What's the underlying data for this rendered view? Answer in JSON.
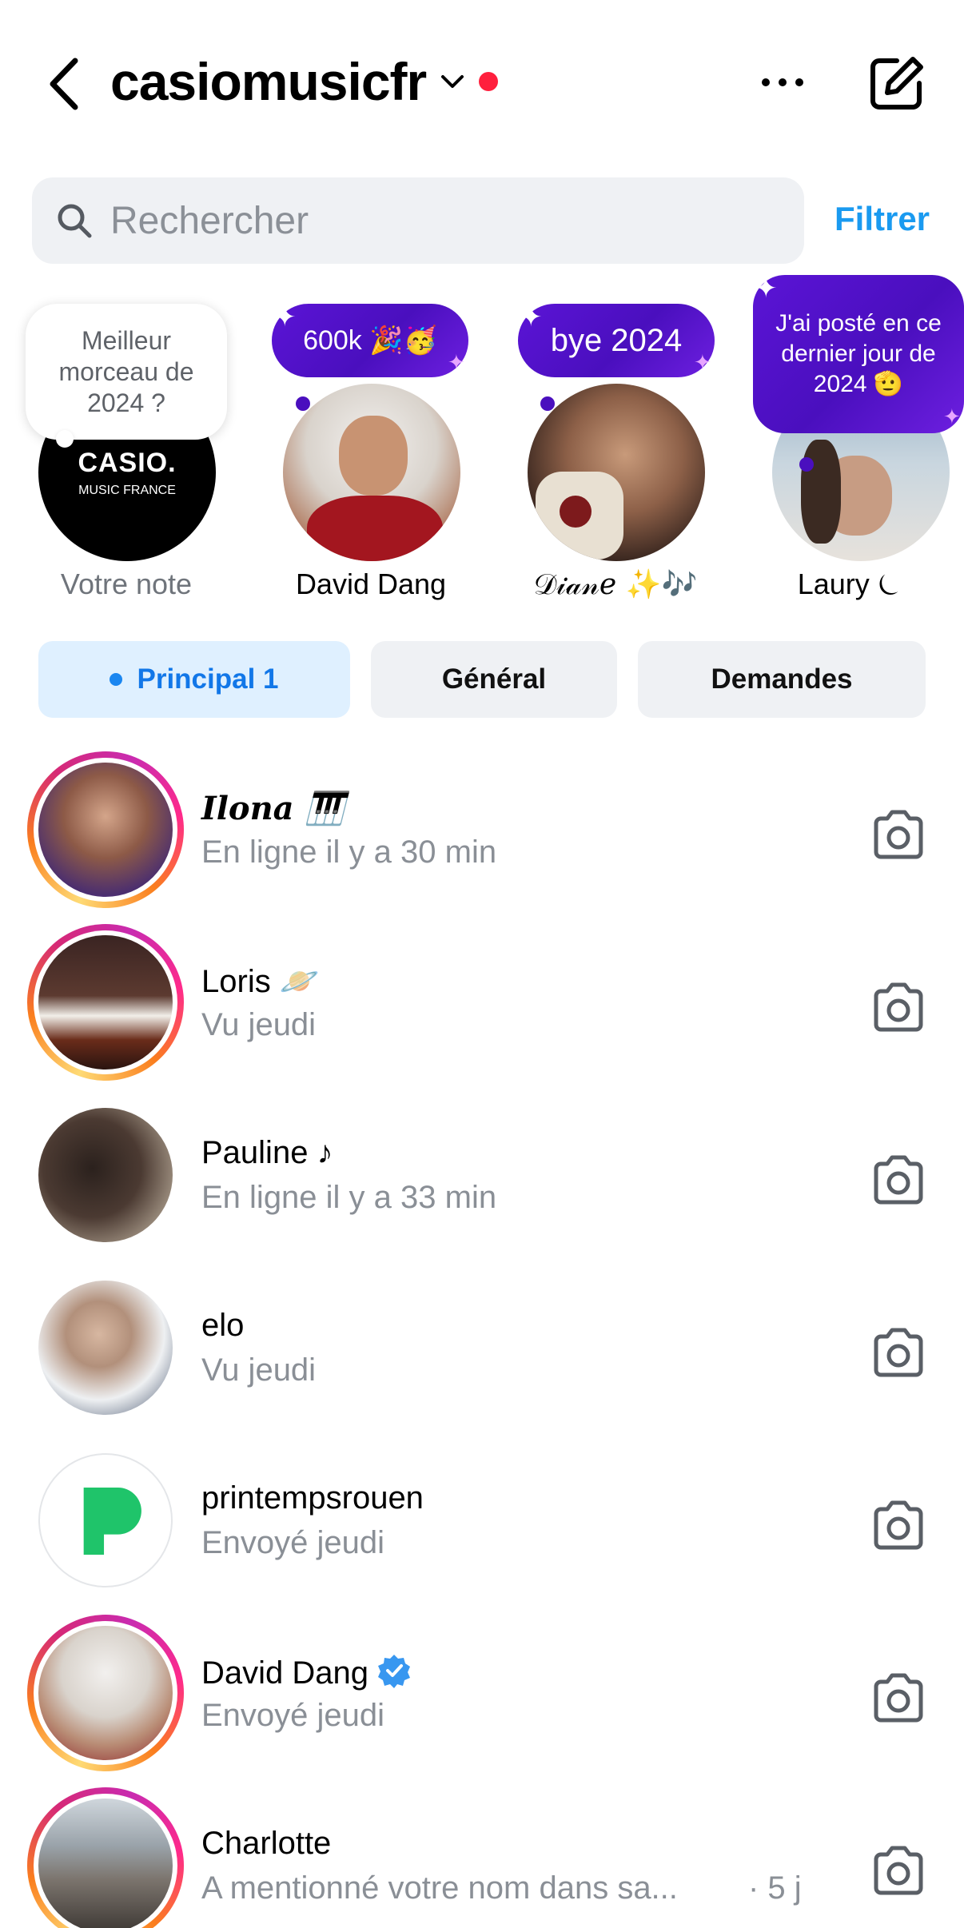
{
  "header": {
    "account_name": "casiomusicfr"
  },
  "search": {
    "placeholder": "Rechercher",
    "filter_label": "Filtrer"
  },
  "notes": [
    {
      "label": "Votre note",
      "note_text": "Meilleur morceau de 2024 ?",
      "avatar_text_1": "CASIO.",
      "avatar_text_2": "MUSIC FRANCE"
    },
    {
      "label": "David Dang",
      "note_text": "600k 🎉🥳"
    },
    {
      "label": "𝒟𝒾𝒶𝓃𝑒 ✨🎶",
      "note_text": "bye 2024"
    },
    {
      "label": "Laury ⏾",
      "note_text": "J'ai posté en ce dernier jour de 2024 🫡"
    }
  ],
  "tabs": [
    {
      "label": "Principal 1"
    },
    {
      "label": "Général"
    },
    {
      "label": "Demandes"
    }
  ],
  "chats": [
    {
      "name": "Ilona 🎹",
      "sub": "En ligne il y a 30 min",
      "time": ""
    },
    {
      "name": "Loris 🪐",
      "sub": "Vu jeudi",
      "time": ""
    },
    {
      "name": "Pauline ♪",
      "sub": "En ligne il y a 33 min",
      "time": ""
    },
    {
      "name": "elo",
      "sub": "Vu jeudi",
      "time": ""
    },
    {
      "name": "printempsrouen",
      "sub": "Envoyé jeudi",
      "time": ""
    },
    {
      "name": "David Dang",
      "sub": "Envoyé jeudi",
      "time": ""
    },
    {
      "name": "Charlotte",
      "sub": "A mentionné votre nom dans sa...",
      "time": "· 5 j"
    }
  ],
  "colors": {
    "accent": "#1a9af0",
    "note_purple": "#4a0fbe",
    "unread_dot": "#ff1f3d"
  }
}
